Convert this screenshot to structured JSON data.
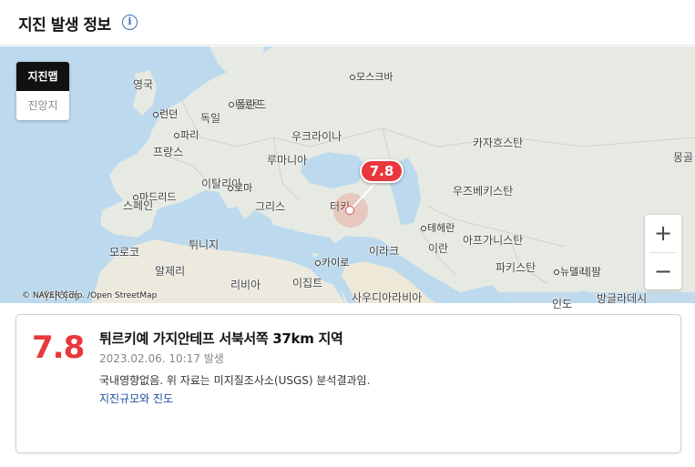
{
  "header": {
    "title": "지진 발생 정보",
    "info_icon": "info-icon"
  },
  "map_toggle": {
    "options": [
      {
        "label": "지진맵",
        "active": true
      },
      {
        "label": "진앙지",
        "active": false
      }
    ]
  },
  "map_labels": {
    "moscow": "모스크바",
    "uk": "영국",
    "london": "런던",
    "berlin": "베를린",
    "poland": "폴란드",
    "germany": "독일",
    "paris": "파리",
    "ukraine": "우크라이나",
    "kazakhstan": "카자흐스탄",
    "mongolia": "몽골",
    "france": "프랑스",
    "romania": "루마니아",
    "italy": "이탈리아",
    "rome": "로마",
    "madrid": "마드리드",
    "spain": "스페인",
    "uzbekistan": "우즈베키스탄",
    "greece": "그리스",
    "turkey": "터키",
    "tehran": "테헤란",
    "morocco": "모로코",
    "tunisia": "튀니지",
    "iraq": "이라크",
    "iran": "이란",
    "afghanistan": "아프가니스탄",
    "algeria": "알제리",
    "cairo": "카이로",
    "pakistan": "파키스탄",
    "new_delhi": "뉴델리",
    "nepal": "네팔",
    "libya": "리비아",
    "egypt": "이집트",
    "saudi": "사우디아라비아",
    "india": "인도",
    "bangladesh": "방글라데시",
    "western_sahara": "서사하라"
  },
  "map_marker": {
    "magnitude": "7.8",
    "color": "#e8383d"
  },
  "zoom": {
    "in": "+",
    "out": "−"
  },
  "copyright": "© NAVER Corp. /Open StreetMap",
  "event": {
    "magnitude": "7.8",
    "location": "튀르키예 가지안테프 서북서쪽 37km 지역",
    "time": "2023.02.06. 10:17 발생",
    "note": "국내영향없음. 위 자료는 미지질조사소(USGS) 분석결과임.",
    "link": "지진규모와 진도"
  },
  "colors": {
    "accent": "#e8383d",
    "link": "#1c4fa0",
    "water": "#bcd9ee",
    "land": "#e8ece6"
  }
}
